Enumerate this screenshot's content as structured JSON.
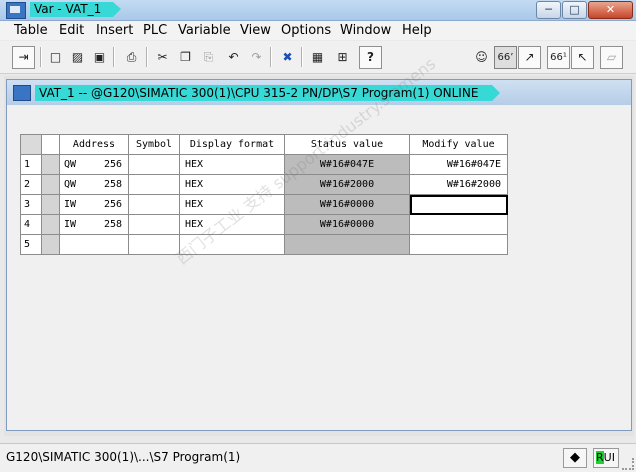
{
  "window": {
    "title": "Var - VAT_1",
    "min": "─",
    "max": "□",
    "close": "✕"
  },
  "menu": [
    "Table",
    "Edit",
    "Insert",
    "PLC",
    "Variable",
    "View",
    "Options",
    "Window",
    "Help"
  ],
  "toolbar": {
    "buttons": [
      "pin-icon",
      "new-icon",
      "open-icon",
      "save-icon",
      "print-icon",
      "cut-icon",
      "copy-icon",
      "paste-icon",
      "undo-icon",
      "redo-icon",
      "delete-icon",
      "network-icon",
      "accessible-nodes-icon",
      "context-help-icon",
      "monitor-glasses-icon",
      "monitor-variable-icon",
      "modify-variable-icon",
      "update-glasses-icon",
      "activate-modify-icon",
      "force-icon"
    ],
    "glyphs": [
      "⇥",
      "□",
      "▨",
      "▣",
      "⎙",
      "✂",
      "❐",
      "⎘",
      "↶",
      "↷",
      "✖",
      "▦",
      "⊞",
      "?",
      "☺",
      "66’",
      "↗",
      "66¹",
      "↖",
      "⏥"
    ]
  },
  "child_window": {
    "title": "VAT_1 -- @G120\\SIMATIC 300(1)\\CPU 315-2 PN/DP\\S7 Program(1)  ONLINE"
  },
  "table": {
    "headers": {
      "address": "Address",
      "symbol": "Symbol",
      "display_format": "Display format",
      "status_value": "Status value",
      "modify_value": "Modify value"
    },
    "rows": [
      {
        "num": "1",
        "op": "QW",
        "addr": "256",
        "symbol": "",
        "format": "HEX",
        "status": "W#16#047E",
        "modify": "W#16#047E"
      },
      {
        "num": "2",
        "op": "QW",
        "addr": "258",
        "symbol": "",
        "format": "HEX",
        "status": "W#16#2000",
        "modify": "W#16#2000"
      },
      {
        "num": "3",
        "op": "IW",
        "addr": "256",
        "symbol": "",
        "format": "HEX",
        "status": "W#16#0000",
        "modify": ""
      },
      {
        "num": "4",
        "op": "IW",
        "addr": "258",
        "symbol": "",
        "format": "HEX",
        "status": "W#16#0000",
        "modify": ""
      },
      {
        "num": "5",
        "op": "",
        "addr": "",
        "symbol": "",
        "format": "",
        "status": "",
        "modify": ""
      }
    ]
  },
  "statusbar": {
    "path": "G120\\SIMATIC 300(1)\\...\\S7 Program(1)",
    "mode_r": "R",
    "mode_rest": "UI"
  },
  "watermark": "西门子工业 支持 support.industry.siemens",
  "colors": {
    "title_highlight": "#37d9d6",
    "status_column": "#bcbcbc",
    "run_indicator": "#1bd22e"
  }
}
